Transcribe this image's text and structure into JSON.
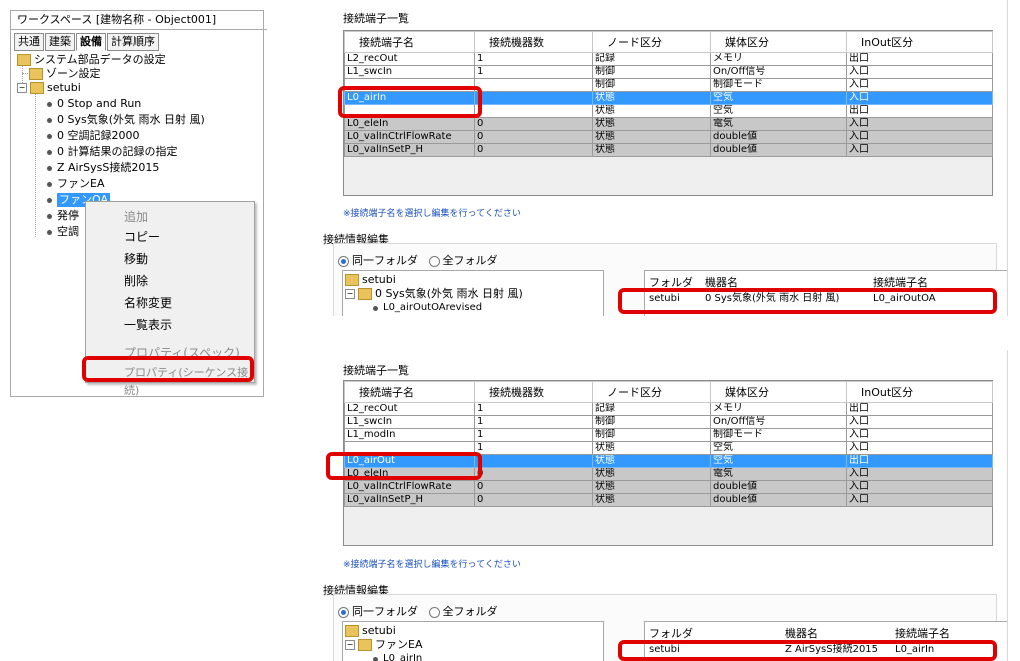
{
  "left_panel": {
    "title": "ワークスペース [建物名称 - Object001]",
    "tabs": [
      "共通",
      "建築",
      "設備",
      "計算順序"
    ],
    "tree": {
      "root": "システム部品データの設定",
      "zone": "ゾーン設定",
      "setubi": "setubi",
      "items": [
        "0 Stop and Run",
        "0 Sys気象(外気 雨水 日射 風)",
        "0 空調記録2000",
        "0 計算結果の記録の指定",
        "Z AirSysS接続2015",
        "ファンEA",
        "ファンOA",
        "発停",
        "空調"
      ]
    },
    "context_menu": [
      "追加",
      "コピー",
      "移動",
      "削除",
      "名称変更",
      "一覧表示",
      "プロパティ(スペック)",
      "プロパティ(シーケンス接続)"
    ]
  },
  "panel1": {
    "title": "接続端子一覧",
    "columns": [
      "接続端子名",
      "接続機器数",
      "ノード区分",
      "媒体区分",
      "InOut区分"
    ],
    "rows": [
      {
        "name": "L2_recOut",
        "count": "1",
        "node": "記録",
        "medium": "メモリ",
        "io": "出口"
      },
      {
        "name": "L1_swcIn",
        "count": "1",
        "node": "制御",
        "medium": "On/Off信号",
        "io": "入口"
      },
      {
        "name": "",
        "count": "",
        "node": "制御",
        "medium": "制御モード",
        "io": "入口"
      },
      {
        "name": "L0_airIn",
        "count": "",
        "node": "状態",
        "medium": "空気",
        "io": "入口"
      },
      {
        "name": "",
        "count": "",
        "node": "状態",
        "medium": "空気",
        "io": "出口"
      },
      {
        "name": "L0_eleIn",
        "count": "0",
        "node": "状態",
        "medium": "電気",
        "io": "入口"
      },
      {
        "name": "L0_valInCtrlFlowRate",
        "count": "0",
        "node": "状態",
        "medium": "double値",
        "io": "入口"
      },
      {
        "name": "L0_valInSetP_H",
        "count": "0",
        "node": "状態",
        "medium": "double値",
        "io": "入口"
      }
    ],
    "note": "※接続端子名を選択し編集を行ってください",
    "edit_title": "接続情報編集",
    "radio_same": "同一フォルダ",
    "radio_all": "全フォルダ",
    "tree": [
      "setubi",
      "0 Sys気象(外気 雨水 日射 風)",
      "L0_airOutOArevised"
    ],
    "conn_headers": [
      "フォルダ",
      "機器名",
      "接続端子名"
    ],
    "conn_row": {
      "folder": "setubi",
      "device": "0 Sys気象(外気 雨水 日射 風)",
      "terminal": "L0_airOutOA"
    }
  },
  "panel2": {
    "title": "接続端子一覧",
    "columns": [
      "接続端子名",
      "接続機器数",
      "ノード区分",
      "媒体区分",
      "InOut区分"
    ],
    "rows": [
      {
        "name": "L2_recOut",
        "count": "1",
        "node": "記録",
        "medium": "メモリ",
        "io": "出口"
      },
      {
        "name": "L1_swcIn",
        "count": "1",
        "node": "制御",
        "medium": "On/Off信号",
        "io": "入口"
      },
      {
        "name": "L1_modIn",
        "count": "1",
        "node": "制御",
        "medium": "制御モード",
        "io": "入口"
      },
      {
        "name": "",
        "count": "1",
        "node": "状態",
        "medium": "空気",
        "io": "入口"
      },
      {
        "name": "L0_airOut",
        "count": "",
        "node": "状態",
        "medium": "空気",
        "io": "出口"
      },
      {
        "name": "L0_eleIn",
        "count": "0",
        "node": "状態",
        "medium": "電気",
        "io": "入口"
      },
      {
        "name": "L0_valInCtrlFlowRate",
        "count": "0",
        "node": "状態",
        "medium": "double値",
        "io": "入口"
      },
      {
        "name": "L0_valInSetP_H",
        "count": "0",
        "node": "状態",
        "medium": "double値",
        "io": "入口"
      }
    ],
    "note": "※接続端子名を選択し編集を行ってください",
    "edit_title": "接続情報編集",
    "radio_same": "同一フォルダ",
    "radio_all": "全フォルダ",
    "tree": [
      "setubi",
      "ファンEA",
      "L0_airIn"
    ],
    "conn_headers": [
      "フォルダ",
      "機器名",
      "接続端子名"
    ],
    "conn_row": {
      "folder": "setubi",
      "device": "Z AirSysS接続2015",
      "terminal": "L0_airIn"
    }
  },
  "colors": {
    "highlight": "#3399ff",
    "callout": "#e00000",
    "disabled_row": "#c8c8c8"
  }
}
